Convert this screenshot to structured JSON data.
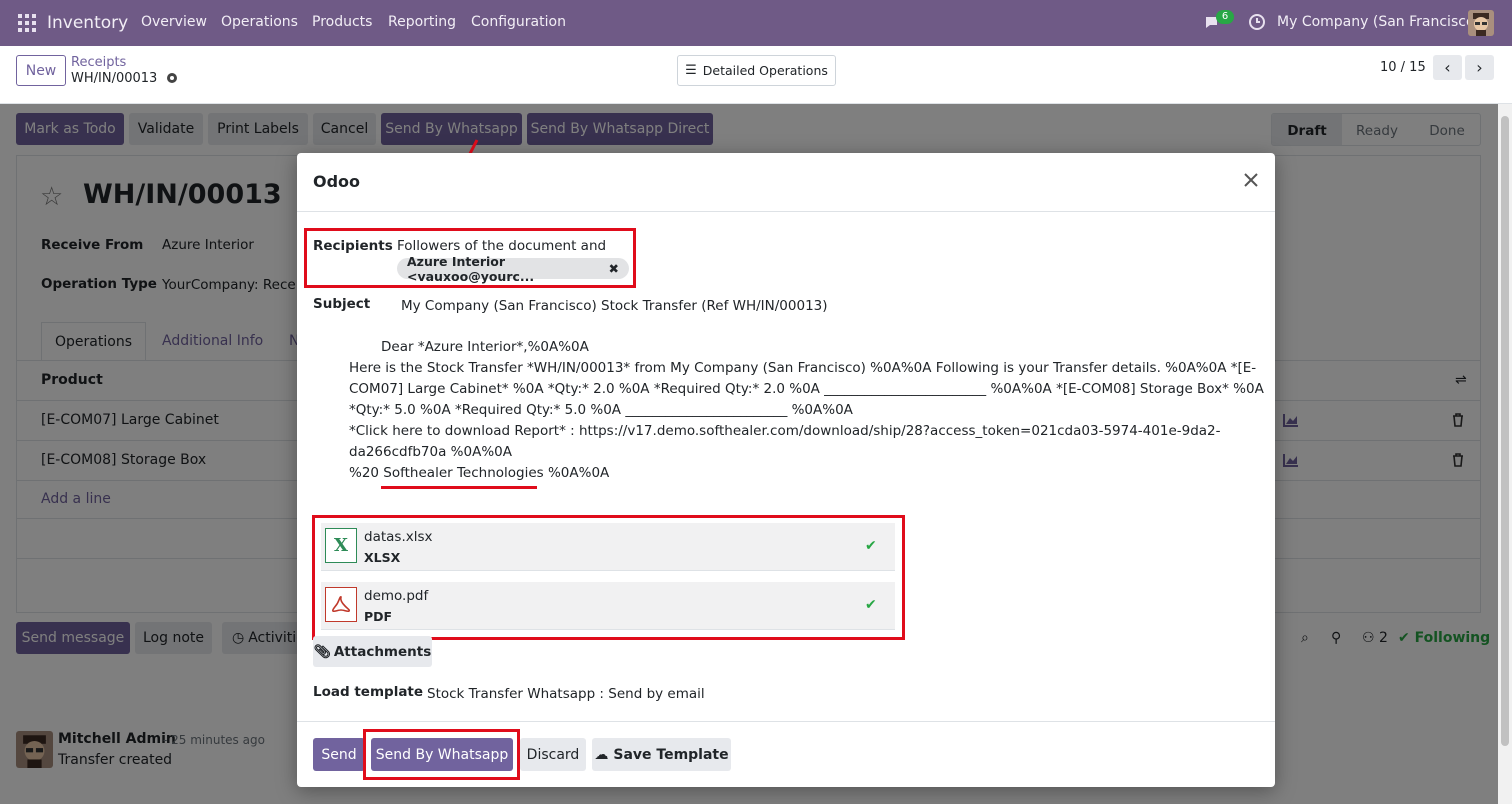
{
  "navbar": {
    "brand": "Inventory",
    "menu": [
      "Overview",
      "Operations",
      "Products",
      "Reporting",
      "Configuration"
    ],
    "chat_count": "6",
    "company": "My Company (San Francisco)"
  },
  "control": {
    "new_label": "New",
    "breadcrumb_parent": "Receipts",
    "record_name": "WH/IN/00013",
    "detailed_ops": "Detailed Operations",
    "pager": "10 / 15"
  },
  "actions": [
    "Mark as Todo",
    "Validate",
    "Print Labels",
    "Cancel",
    "Send By Whatsapp",
    "Send By Whatsapp Direct"
  ],
  "status": [
    "Draft",
    "Ready",
    "Done"
  ],
  "form": {
    "title": "WH/IN/00013",
    "receive_from_label": "Receive From",
    "receive_from_value": "Azure Interior",
    "operation_type_label": "Operation Type",
    "operation_type_value": "YourCompany: Receipts",
    "tabs": [
      "Operations",
      "Additional Info",
      "Note"
    ],
    "product_header": "Product",
    "lines": [
      "[E-COM07] Large Cabinet",
      "[E-COM08] Storage Box"
    ],
    "add_line": "Add a line"
  },
  "chatter": {
    "send_message": "Send message",
    "log_note": "Log note",
    "activities": "Activities",
    "attachments_count": "2",
    "following": "Following",
    "author": "Mitchell Admin",
    "time": "- 25 minutes ago",
    "message": "Transfer created"
  },
  "modal": {
    "title": "Odoo",
    "recipients_label": "Recipients",
    "recipients_text": "Followers of the document and",
    "recipient_tag": "Azure Interior <vauxoo@yourc...",
    "subject_label": "Subject",
    "subject_value": "My Company (San Francisco) Stock Transfer (Ref WH/IN/00013)",
    "body_lines": [
      "Dear *Azure Interior*,%0A%0A",
      "Here is the Stock Transfer *WH/IN/00013* from My Company (San Francisco) %0A%0A Following is your Transfer details. %0A%0A *[E-",
      "COM07] Large Cabinet* %0A *Qty:* 2.0 %0A *Required Qty:* 2.0 %0A ________________________ %0A%0A *[E-COM08] Storage Box* %0A",
      "*Qty:* 5.0 %0A *Required Qty:* 5.0 %0A ________________________ %0A%0A",
      "*Click here to download Report* : https://v17.demo.softhealer.com/download/ship/28?access_token=021cda03-5974-401e-9da2-",
      "da266cdfb70a %0A%0A",
      "%20 Softhealer Technologies %0A%0A"
    ],
    "attachments": [
      {
        "name": "datas.xlsx",
        "type": "XLSX"
      },
      {
        "name": "demo.pdf",
        "type": "PDF"
      }
    ],
    "attachments_button": "Attachments",
    "load_template_label": "Load template",
    "load_template_value": "Stock Transfer Whatsapp : Send by email",
    "footer": {
      "send": "Send",
      "send_whatsapp": "Send By Whatsapp",
      "discard": "Discard",
      "save_template": "Save Template"
    }
  },
  "colors": {
    "brand": "#71639e",
    "navbar": "#6f5a86",
    "highlight": "#e00c1b",
    "check": "#28a745"
  }
}
